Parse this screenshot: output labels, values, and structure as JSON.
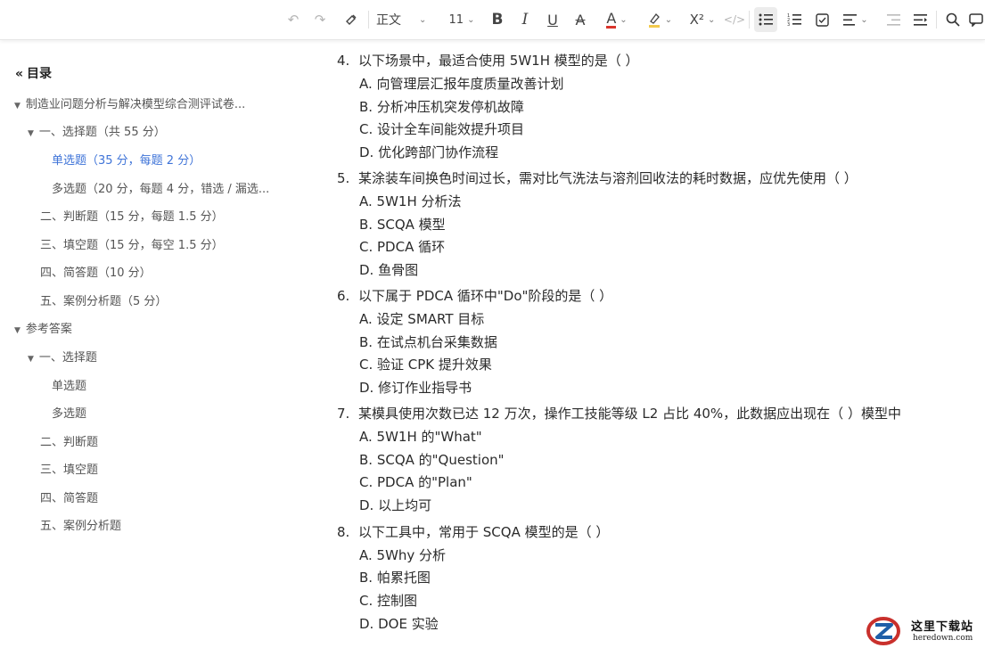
{
  "toolbar": {
    "style_label": "正文",
    "font_size": "11",
    "superscript_label": "X²",
    "code_label": "</>",
    "bold_label": "B",
    "italic_label": "I",
    "underline_label": "U",
    "strike_label": "A",
    "color_label": "A"
  },
  "toc": {
    "title": "目录",
    "items": [
      {
        "label": "制造业问题分析与解决模型综合测评试卷..."
      },
      {
        "label": "一、选择题（共 55 分）"
      },
      {
        "label": "单选题（35 分，每题 2 分）"
      },
      {
        "label": "多选题（20 分，每题 4 分，错选 / 漏选..."
      },
      {
        "label": "二、判断题（15 分，每题 1.5 分）"
      },
      {
        "label": "三、填空题（15 分，每空 1.5 分）"
      },
      {
        "label": "四、简答题（10 分）"
      },
      {
        "label": "五、案例分析题（5 分）"
      },
      {
        "label": "参考答案"
      },
      {
        "label": "一、选择题"
      },
      {
        "label": "单选题"
      },
      {
        "label": "多选题"
      },
      {
        "label": "二、判断题"
      },
      {
        "label": "三、填空题"
      },
      {
        "label": "四、简答题"
      },
      {
        "label": "五、案例分析题"
      }
    ]
  },
  "questions": [
    {
      "num": "4.",
      "text": "以下场景中，最适合使用 5W1H 模型的是（ ）",
      "options": [
        "A. 向管理层汇报年度质量改善计划",
        "B. 分析冲压机突发停机故障",
        "C. 设计全车间能效提升项目",
        "D. 优化跨部门协作流程"
      ]
    },
    {
      "num": "5.",
      "text": "某涂装车间换色时间过长，需对比气洗法与溶剂回收法的耗时数据，应优先使用（ ）",
      "options": [
        "A. 5W1H 分析法",
        "B. SCQA 模型",
        "C. PDCA 循环",
        "D. 鱼骨图"
      ]
    },
    {
      "num": "6.",
      "text": "以下属于 PDCA 循环中\"Do\"阶段的是（ ）",
      "options": [
        "A. 设定 SMART 目标",
        "B. 在试点机台采集数据",
        "C. 验证 CPK 提升效果",
        "D. 修订作业指导书"
      ]
    },
    {
      "num": "7.",
      "text": "某模具使用次数已达 12 万次，操作工技能等级 L2 占比 40%，此数据应出现在（ ）模型中",
      "options": [
        "A. 5W1H 的\"What\"",
        "B. SCQA 的\"Question\"",
        "C. PDCA 的\"Plan\"",
        "D. 以上均可"
      ]
    },
    {
      "num": "8.",
      "text": "以下工具中，常用于 SCQA 模型的是（ ）",
      "options": [
        "A. 5Why 分析",
        "B. 帕累托图",
        "C. 控制图",
        "D. DOE 实验"
      ]
    }
  ],
  "watermark": {
    "name": "这里下载站",
    "url": "heredown.com"
  }
}
